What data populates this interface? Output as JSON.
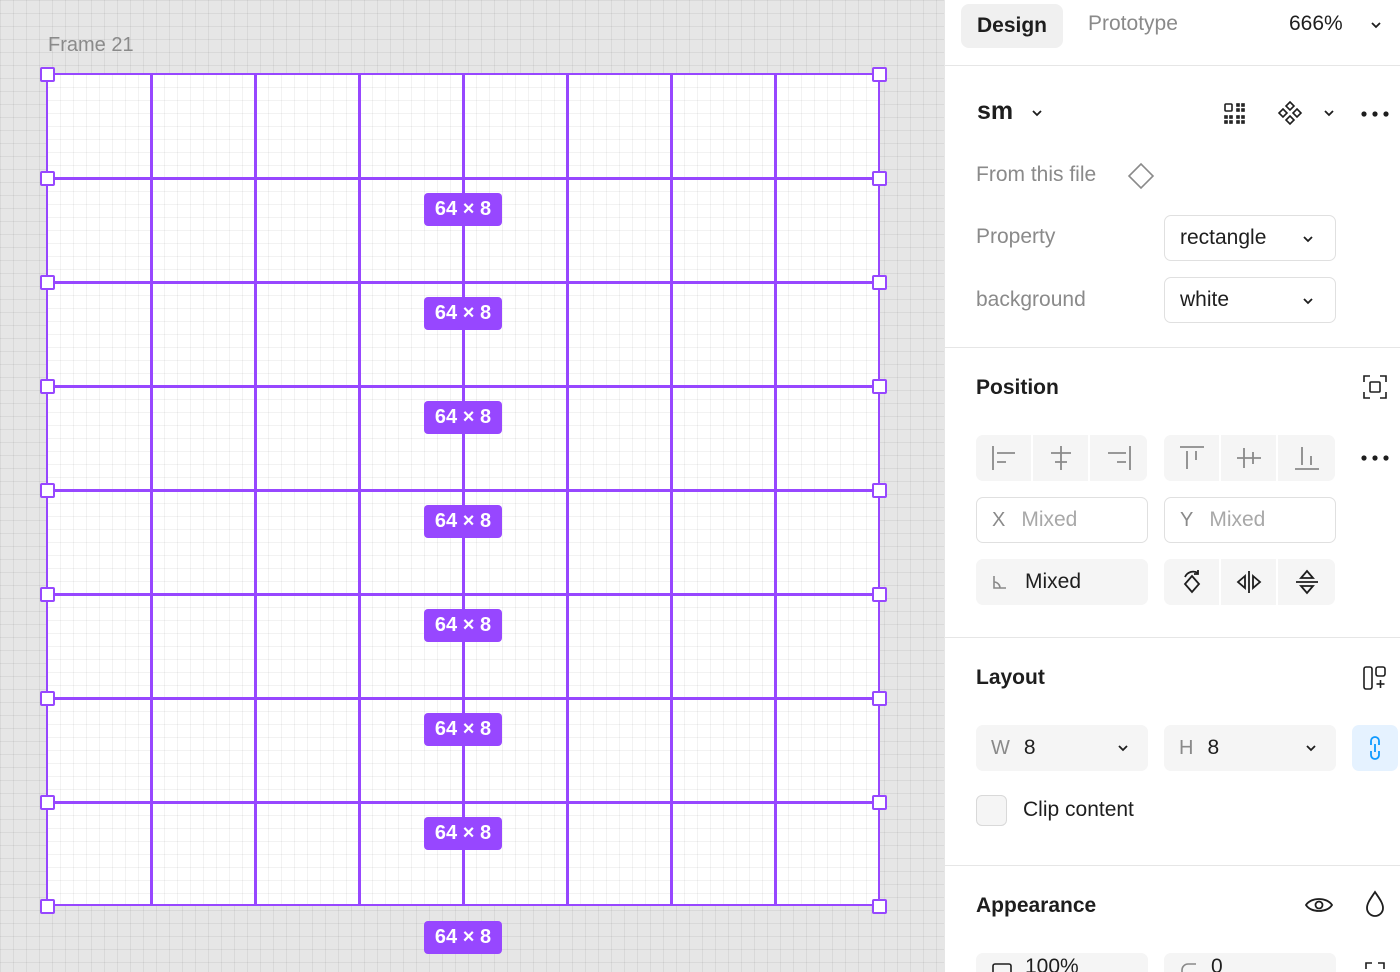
{
  "canvas": {
    "frame_label": "Frame 21",
    "row_dimension_label": "64 × 8",
    "badge_count": 8
  },
  "panel": {
    "tabs": {
      "design": "Design",
      "prototype": "Prototype"
    },
    "zoom": "666%",
    "component": {
      "name": "sm",
      "source": "From this file",
      "properties": [
        {
          "label": "Property",
          "value": "rectangle"
        },
        {
          "label": "background",
          "value": "white"
        }
      ]
    },
    "position": {
      "title": "Position",
      "x_prefix": "X",
      "x_value": "Mixed",
      "y_prefix": "Y",
      "y_value": "Mixed",
      "rotation_value": "Mixed"
    },
    "layout": {
      "title": "Layout",
      "w_prefix": "W",
      "w_value": "8",
      "h_prefix": "H",
      "h_value": "8",
      "clip_content_label": "Clip content"
    },
    "appearance": {
      "title": "Appearance",
      "opacity_value": "100%",
      "radius_value": "0"
    }
  },
  "colors": {
    "accent": "#9747ff",
    "ratio_lock": "#0d99ff"
  },
  "icons": [
    "chevron-down-icon",
    "instance-grid-icon",
    "component-icon",
    "more-icon",
    "component-diamond-icon",
    "resize-to-fit-icon",
    "align-left-icon",
    "align-h-center-icon",
    "align-right-icon",
    "align-top-icon",
    "align-v-center-icon",
    "align-bottom-icon",
    "rotate-icon",
    "flip-horizontal-icon",
    "flip-vertical-icon",
    "auto-layout-icon",
    "link-icon",
    "eye-icon",
    "drop-icon"
  ]
}
